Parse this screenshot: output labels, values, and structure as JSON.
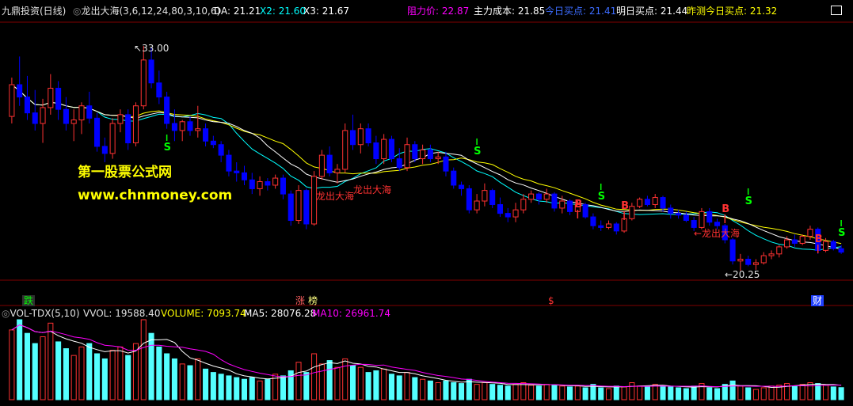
{
  "header": {
    "app_title": "九鼎投资(日线)",
    "indicator": "龙出大海(3,6,12,24,80,3,10,6)",
    "da": "DA: 21.21",
    "x2": "X2: 21.60",
    "x3": "X3: 21.67",
    "resistance": "阻力价: 22.87",
    "main_cost": "主力成本: 21.85",
    "today_buy": "今日买点: 21.41",
    "tomorrow_buy": "明日买点: 21.44",
    "yesterday_pred": "昨测今日买点: 21.32"
  },
  "watermark": {
    "line1": "第一股票公式网",
    "line2": "www.chnmoney.com"
  },
  "annotations": {
    "high": "33.00",
    "low": "←20.25",
    "dragon1": "龙出大海",
    "dragon2": "龙出大海",
    "dragon3": "←龙出大海",
    "b": "B",
    "s": "S"
  },
  "event_tags": [
    "跌",
    "涨",
    "榜",
    "$",
    "财"
  ],
  "vol_header": {
    "name": "VOL-TDX(5,10)",
    "vvol": "VVOL: 19588.40",
    "volume": "VOLUME: 7093.74",
    "ma5": "MA5: 28076.28",
    "ma10": "MA10: 26961.74"
  },
  "colors": {
    "up": "#ff3232",
    "down": "#0000ff",
    "vol_down": "#54ffff",
    "vol_up": "#ff3232",
    "ma_white": "#ffffff",
    "ma_yellow": "#ffff00",
    "ma_cyan": "#00ffff",
    "ma10": "#ff00ff",
    "grid": "#800000",
    "watermark": "#ffff00",
    "buy": "#ff3232",
    "sell": "#00ff00"
  },
  "chart_data": {
    "type": "candlestick",
    "ylim": [
      20.25,
      33.0
    ],
    "ohlc": [
      [
        29.0,
        31.2,
        28.6,
        30.8
      ],
      [
        30.8,
        32.4,
        29.6,
        30.1
      ],
      [
        30.1,
        31.3,
        28.8,
        29.2
      ],
      [
        29.2,
        30.5,
        28.2,
        28.6
      ],
      [
        28.6,
        30.0,
        27.5,
        29.5
      ],
      [
        29.5,
        31.4,
        29.1,
        30.6
      ],
      [
        30.6,
        31.0,
        28.8,
        29.4
      ],
      [
        29.4,
        30.1,
        28.2,
        28.6
      ],
      [
        28.6,
        29.4,
        27.6,
        28.8
      ],
      [
        28.8,
        29.8,
        28.0,
        29.6
      ],
      [
        29.6,
        30.4,
        28.6,
        28.9
      ],
      [
        28.9,
        29.2,
        27.0,
        27.3
      ],
      [
        27.3,
        27.8,
        26.4,
        26.9
      ],
      [
        26.9,
        28.9,
        26.6,
        28.6
      ],
      [
        28.6,
        29.4,
        28.1,
        29.1
      ],
      [
        29.1,
        29.4,
        27.1,
        27.5
      ],
      [
        27.5,
        29.8,
        27.3,
        29.6
      ],
      [
        29.6,
        33.0,
        29.4,
        32.2
      ],
      [
        32.2,
        32.9,
        30.6,
        30.9
      ],
      [
        30.9,
        31.6,
        29.7,
        30.1
      ],
      [
        30.1,
        30.4,
        28.3,
        28.6
      ],
      [
        28.6,
        29.4,
        27.6,
        28.2
      ],
      [
        28.2,
        28.8,
        27.6,
        28.7
      ],
      [
        28.7,
        29.0,
        27.9,
        28.2
      ],
      [
        28.2,
        29.6,
        27.8,
        28.3
      ],
      [
        28.3,
        28.6,
        27.3,
        27.6
      ],
      [
        27.6,
        27.9,
        27.2,
        27.4
      ],
      [
        27.4,
        27.6,
        26.4,
        26.8
      ],
      [
        26.8,
        27.1,
        25.6,
        25.9
      ],
      [
        25.9,
        26.4,
        25.3,
        25.8
      ],
      [
        25.8,
        26.2,
        25.1,
        25.4
      ],
      [
        25.4,
        25.8,
        24.6,
        24.9
      ],
      [
        24.9,
        25.6,
        24.5,
        25.3
      ],
      [
        25.3,
        25.5,
        24.8,
        25.1
      ],
      [
        25.1,
        25.7,
        24.9,
        25.5
      ],
      [
        25.5,
        25.7,
        24.3,
        24.6
      ],
      [
        24.6,
        24.8,
        22.8,
        23.1
      ],
      [
        23.1,
        25.1,
        22.9,
        24.8
      ],
      [
        24.8,
        24.9,
        22.6,
        22.9
      ],
      [
        22.9,
        25.9,
        22.8,
        25.6
      ],
      [
        25.6,
        27.1,
        25.4,
        26.8
      ],
      [
        26.8,
        27.3,
        25.6,
        25.8
      ],
      [
        25.8,
        26.3,
        25.2,
        26.0
      ],
      [
        26.0,
        28.6,
        25.8,
        28.2
      ],
      [
        28.2,
        29.1,
        27.1,
        27.4
      ],
      [
        27.4,
        28.6,
        26.9,
        28.3
      ],
      [
        28.3,
        28.6,
        27.3,
        27.5
      ],
      [
        27.5,
        27.9,
        26.3,
        26.6
      ],
      [
        26.6,
        28.0,
        26.3,
        27.7
      ],
      [
        27.7,
        27.9,
        26.4,
        26.6
      ],
      [
        26.6,
        27.2,
        25.9,
        26.1
      ],
      [
        26.1,
        27.8,
        25.9,
        27.4
      ],
      [
        27.4,
        27.6,
        26.4,
        26.6
      ],
      [
        26.6,
        27.4,
        26.3,
        27.1
      ],
      [
        27.1,
        27.4,
        26.4,
        26.6
      ],
      [
        26.6,
        27.0,
        26.3,
        26.7
      ],
      [
        26.7,
        27.0,
        25.6,
        25.9
      ],
      [
        25.9,
        26.1,
        24.9,
        25.1
      ],
      [
        25.1,
        25.3,
        24.5,
        24.9
      ],
      [
        24.9,
        25.1,
        23.5,
        23.7
      ],
      [
        23.7,
        24.6,
        23.5,
        24.2
      ],
      [
        24.2,
        25.2,
        23.9,
        24.8
      ],
      [
        24.8,
        24.9,
        23.8,
        24.0
      ],
      [
        24.0,
        24.4,
        23.3,
        23.5
      ],
      [
        23.5,
        23.8,
        23.0,
        23.3
      ],
      [
        23.3,
        24.1,
        23.0,
        23.7
      ],
      [
        23.7,
        24.6,
        23.5,
        24.3
      ],
      [
        24.3,
        24.8,
        24.1,
        24.6
      ],
      [
        24.6,
        24.7,
        24.0,
        24.3
      ],
      [
        24.3,
        24.9,
        24.1,
        24.6
      ],
      [
        24.6,
        24.7,
        23.6,
        23.8
      ],
      [
        23.8,
        24.5,
        23.5,
        24.2
      ],
      [
        24.2,
        24.3,
        23.4,
        23.6
      ],
      [
        23.6,
        24.2,
        23.4,
        24.0
      ],
      [
        24.0,
        24.1,
        23.2,
        23.3
      ],
      [
        23.3,
        23.5,
        22.6,
        22.8
      ],
      [
        22.8,
        23.1,
        22.5,
        22.7
      ],
      [
        22.7,
        23.1,
        22.6,
        22.9
      ],
      [
        22.9,
        23.0,
        22.3,
        22.5
      ],
      [
        22.5,
        23.4,
        22.4,
        23.2
      ],
      [
        23.2,
        24.1,
        23.1,
        23.9
      ],
      [
        23.9,
        24.4,
        23.8,
        24.3
      ],
      [
        24.3,
        24.5,
        23.9,
        24.0
      ],
      [
        24.0,
        24.6,
        23.8,
        24.4
      ],
      [
        24.4,
        24.5,
        23.6,
        23.8
      ],
      [
        23.8,
        24.0,
        23.2,
        23.5
      ],
      [
        23.5,
        23.7,
        23.2,
        23.4
      ],
      [
        23.4,
        23.6,
        23.0,
        23.1
      ],
      [
        23.1,
        23.3,
        22.5,
        22.7
      ],
      [
        22.7,
        23.8,
        22.6,
        23.6
      ],
      [
        23.6,
        23.8,
        22.8,
        23.0
      ],
      [
        23.0,
        23.2,
        22.6,
        22.8
      ],
      [
        22.8,
        22.9,
        21.8,
        22.0
      ],
      [
        22.0,
        22.1,
        20.6,
        20.8
      ],
      [
        20.8,
        21.2,
        20.25,
        20.9
      ],
      [
        20.9,
        21.1,
        20.5,
        20.6
      ],
      [
        20.6,
        20.9,
        20.3,
        20.7
      ],
      [
        20.7,
        21.3,
        20.6,
        21.1
      ],
      [
        21.1,
        21.4,
        20.9,
        21.2
      ],
      [
        21.2,
        21.7,
        21.0,
        21.6
      ],
      [
        21.6,
        22.2,
        21.5,
        22.0
      ],
      [
        22.0,
        22.3,
        21.6,
        21.8
      ],
      [
        21.8,
        22.3,
        21.7,
        22.2
      ],
      [
        22.2,
        22.8,
        22.0,
        22.6
      ],
      [
        22.6,
        22.7,
        21.2,
        21.4
      ],
      [
        21.4,
        22.1,
        21.3,
        21.9
      ],
      [
        21.9,
        22.0,
        21.4,
        21.5
      ],
      [
        21.5,
        21.7,
        21.2,
        21.3
      ]
    ],
    "volume": [
      41000,
      47000,
      39000,
      33000,
      37000,
      45000,
      34000,
      30000,
      26000,
      31000,
      33000,
      27000,
      24000,
      29000,
      31000,
      26000,
      33000,
      47000,
      39000,
      31000,
      27000,
      24000,
      21000,
      20000,
      24000,
      18000,
      16000,
      15000,
      14000,
      13000,
      12000,
      13000,
      11000,
      12000,
      15000,
      14000,
      17000,
      22000,
      16000,
      27000,
      21000,
      23000,
      19000,
      24000,
      20000,
      19000,
      16000,
      17000,
      18000,
      15000,
      14000,
      16000,
      13000,
      12000,
      11000,
      10000,
      11000,
      10000,
      9500,
      12000,
      9000,
      10000,
      9000,
      8500,
      8000,
      9000,
      10000,
      8500,
      8000,
      9000,
      8500,
      8000,
      7500,
      8000,
      7000,
      9000,
      7000,
      6500,
      8000,
      7500,
      10000,
      8000,
      7500,
      9000,
      8000,
      7500,
      7000,
      6500,
      8000,
      9500,
      7000,
      6500,
      9000,
      11000,
      8000,
      7000,
      6000,
      7000,
      8000,
      8500,
      9500,
      8000,
      9000,
      10000,
      9500,
      8500,
      7500,
      7093.74
    ]
  }
}
